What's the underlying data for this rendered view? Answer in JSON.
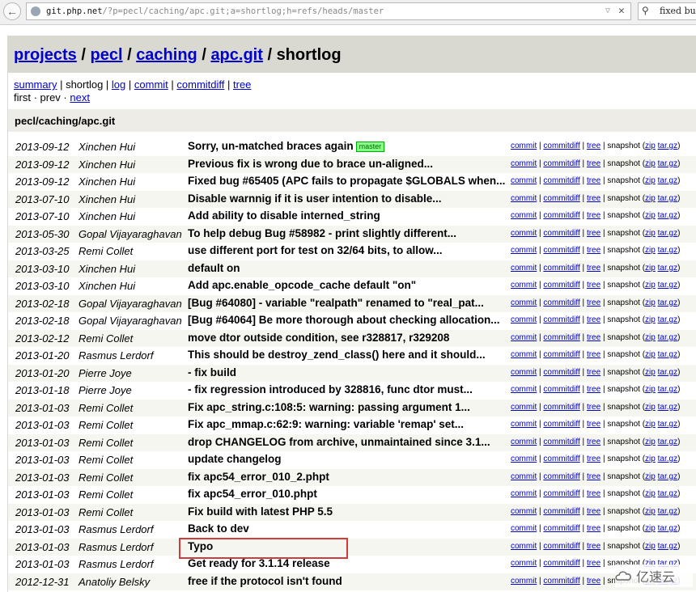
{
  "browser": {
    "url_host": "git.php.net",
    "url_rest": "/?p=pecl/caching/apc.git;a=shortlog;h=refs/heads/master",
    "search_query": "fixed bu"
  },
  "header": {
    "crumbs": [
      "projects",
      "pecl",
      "caching",
      "apc.git"
    ],
    "current": "shortlog",
    "separator": " / "
  },
  "nav": {
    "summary": "summary",
    "shortlog": "shortlog",
    "log": "log",
    "commit": "commit",
    "commitdiff": "commitdiff",
    "tree": "tree",
    "first": "first",
    "prev": "prev",
    "next": "next"
  },
  "project_title": "pecl/caching/apc.git",
  "links": {
    "commit": "commit",
    "commitdiff": "commitdiff",
    "tree": "tree",
    "snapshot": "snapshot",
    "zip": "zip",
    "targz": "tar.gz"
  },
  "commits": [
    {
      "date": "2013-09-12",
      "author": "Xinchen Hui",
      "message": "Sorry, un-matched braces again",
      "badge": "master"
    },
    {
      "date": "2013-09-12",
      "author": "Xinchen Hui",
      "message": "Previous fix is wrong due to brace un-aligned..."
    },
    {
      "date": "2013-09-12",
      "author": "Xinchen Hui",
      "message": "Fixed bug #65405 (APC fails to propagate $GLOBALS when..."
    },
    {
      "date": "2013-07-10",
      "author": "Xinchen Hui",
      "message": "Disable warnnig if it is user intention to disable..."
    },
    {
      "date": "2013-07-10",
      "author": "Xinchen Hui",
      "message": "Add ability to disable interned_string"
    },
    {
      "date": "2013-05-30",
      "author": "Gopal Vijayaraghavan",
      "message": "To help debug Bug #58982 - print slightly different..."
    },
    {
      "date": "2013-03-25",
      "author": "Remi Collet",
      "message": "use different port for test on 32/64 bits, to allow..."
    },
    {
      "date": "2013-03-10",
      "author": "Xinchen Hui",
      "message": "default on"
    },
    {
      "date": "2013-03-10",
      "author": "Xinchen Hui",
      "message": "Add apc.enable_opcode_cache default \"on\""
    },
    {
      "date": "2013-02-18",
      "author": "Gopal Vijayaraghavan",
      "message": "[Bug #64080] - variable \"realpath\" renamed to \"real_pat..."
    },
    {
      "date": "2013-02-18",
      "author": "Gopal Vijayaraghavan",
      "message": "[Bug #64064] Be more thorough about checking allocation..."
    },
    {
      "date": "2013-02-12",
      "author": "Remi Collet",
      "message": "move dtor outside condition, see r328817, r329208"
    },
    {
      "date": "2013-01-20",
      "author": "Rasmus Lerdorf",
      "message": "This should be destroy_zend_class() here and it should..."
    },
    {
      "date": "2013-01-20",
      "author": "Pierre Joye",
      "message": "- fix build"
    },
    {
      "date": "2013-01-18",
      "author": "Pierre Joye",
      "message": "- fix regression introduced by 328816, func dtor must..."
    },
    {
      "date": "2013-01-03",
      "author": "Remi Collet",
      "message": "Fix apc_string.c:108:5: warning: passing argument 1..."
    },
    {
      "date": "2013-01-03",
      "author": "Remi Collet",
      "message": "Fix apc_mmap.c:62:9: warning: variable 'remap' set..."
    },
    {
      "date": "2013-01-03",
      "author": "Remi Collet",
      "message": "drop CHANGELOG from archive, unmaintained since 3.1..."
    },
    {
      "date": "2013-01-03",
      "author": "Remi Collet",
      "message": "update changelog"
    },
    {
      "date": "2013-01-03",
      "author": "Remi Collet",
      "message": "fix apc54_error_010_2.phpt"
    },
    {
      "date": "2013-01-03",
      "author": "Remi Collet",
      "message": "fix apc54_error_010.phpt"
    },
    {
      "date": "2013-01-03",
      "author": "Remi Collet",
      "message": "Fix build with latest PHP 5.5"
    },
    {
      "date": "2013-01-03",
      "author": "Rasmus Lerdorf",
      "message": "Back to dev"
    },
    {
      "date": "2013-01-03",
      "author": "Rasmus Lerdorf",
      "message": "Typo"
    },
    {
      "date": "2013-01-03",
      "author": "Rasmus Lerdorf",
      "message": "Get ready for 3.1.14 release"
    },
    {
      "date": "2012-12-31",
      "author": "Anatoliy Belsky",
      "message": "free if the protocol isn't found"
    }
  ],
  "watermark": "亿速云",
  "colors": {
    "link": "#0000cc",
    "header_bg": "#d9d8d1",
    "highlight_box": "#d43a3a",
    "badge_bg": "#88ff88"
  }
}
